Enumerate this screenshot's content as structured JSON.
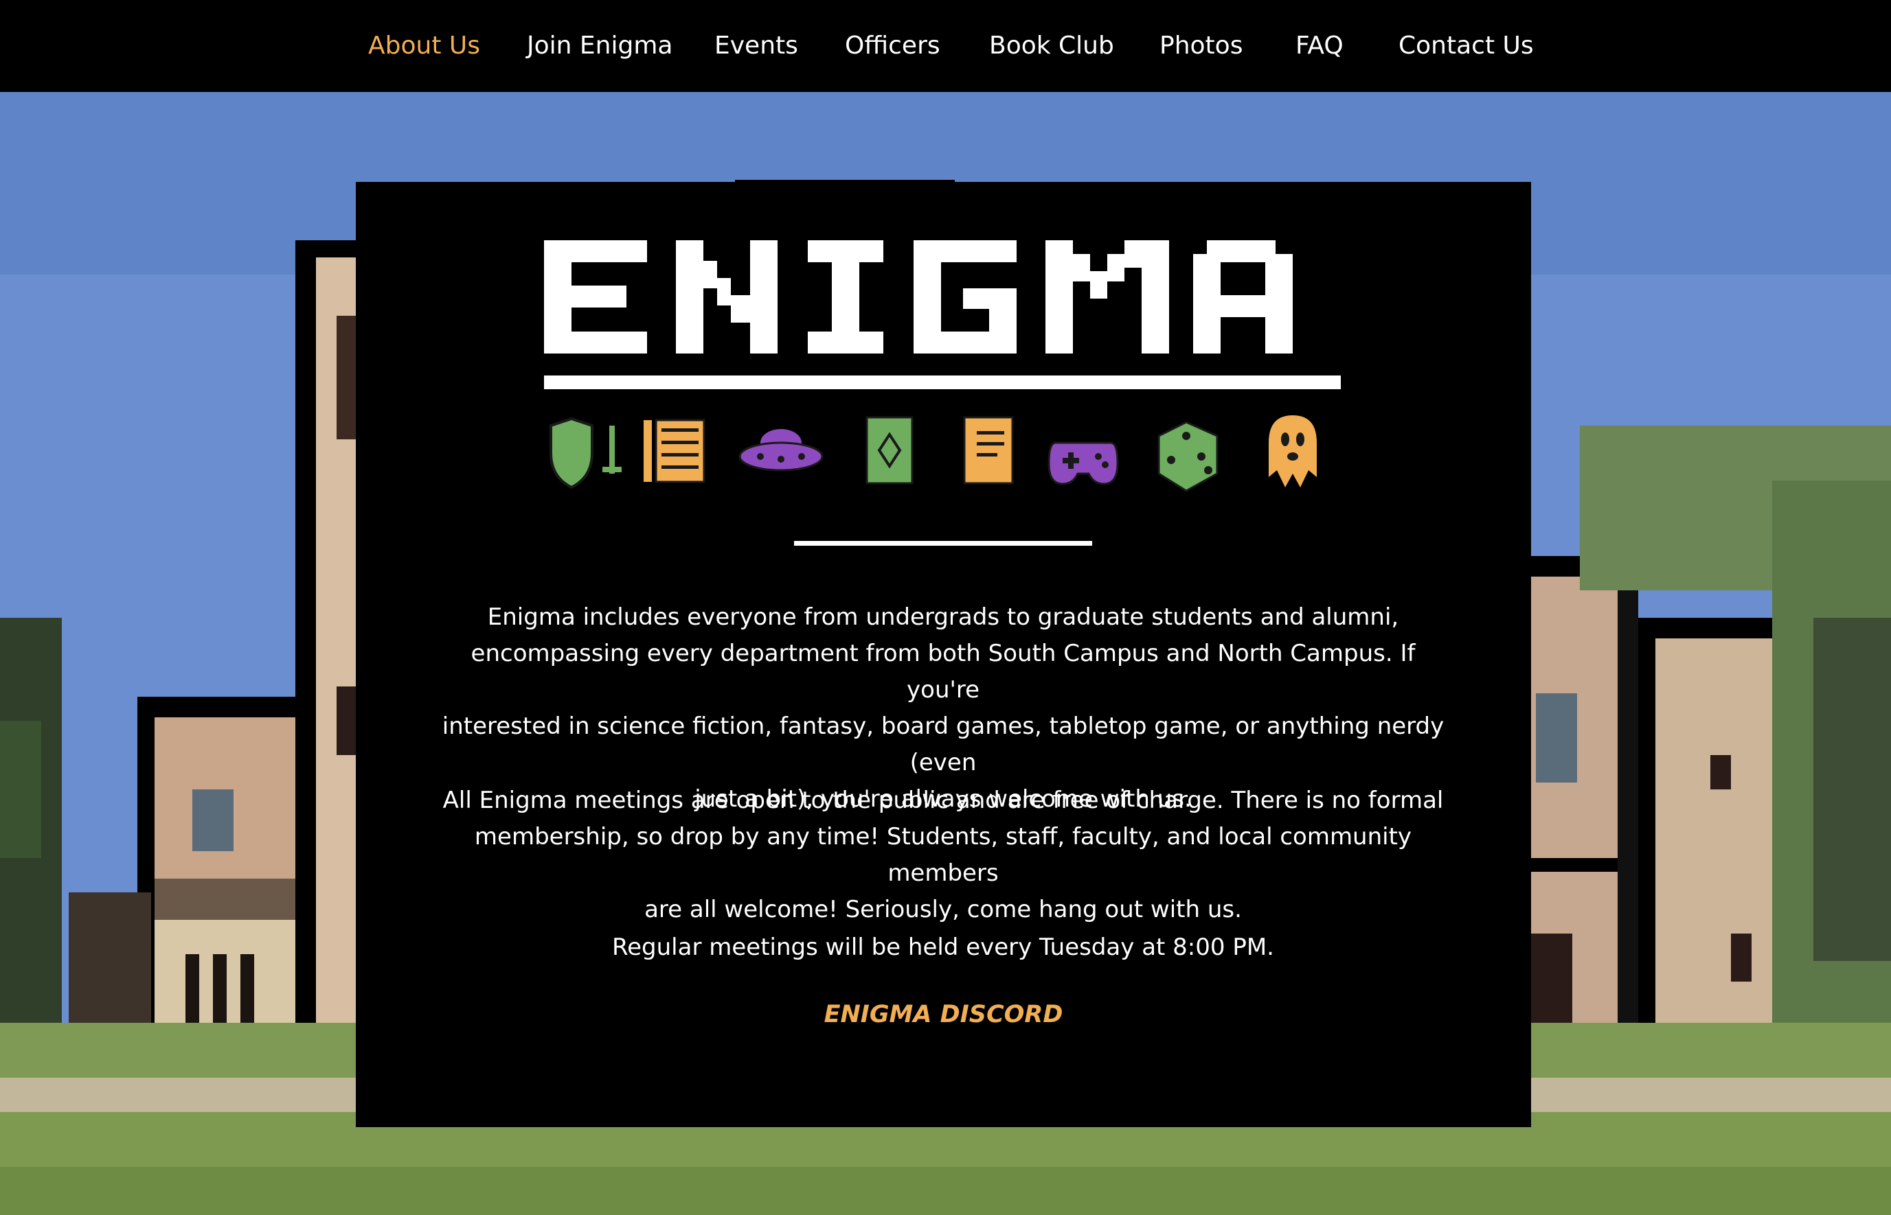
{
  "nav": {
    "items": [
      {
        "label": "About Us",
        "active": true
      },
      {
        "label": "Join Enigma",
        "active": false
      },
      {
        "label": "Events",
        "active": false
      },
      {
        "label": "Officers",
        "active": false
      },
      {
        "label": "Book Club",
        "active": false
      },
      {
        "label": "Photos",
        "active": false
      },
      {
        "label": "FAQ",
        "active": false
      },
      {
        "label": "Contact Us",
        "active": false
      }
    ]
  },
  "logo": {
    "wordmark": "ENIGMA",
    "icons": [
      "shield-sword-icon",
      "notebook-icon",
      "ufo-icon",
      "playing-card-icon",
      "book-icon",
      "gamepad-icon",
      "dice-icon",
      "ghost-icon"
    ]
  },
  "content": {
    "paragraph_1_lines": [
      "Enigma includes everyone from undergrads to graduate students and alumni,",
      "encompassing every department from both South Campus and North Campus. If you're",
      "interested in science fiction, fantasy, board games, tabletop game, or anything nerdy (even",
      "just a bit), you're always welcome with us."
    ],
    "paragraph_2_lines": [
      "All Enigma meetings are open to the public and are free of charge. There is no formal",
      "membership, so drop by any time! Students, staff, faculty, and local community members",
      "are all welcome! Seriously, come hang out with us."
    ],
    "paragraph_3": "Regular meetings will be held every Tuesday at 8:00 PM.",
    "discord_link": "ENIGMA DISCORD"
  },
  "colors": {
    "accent": "#f2ae52",
    "nav_bg": "#000000",
    "panel_bg": "#000000",
    "text": "#ffffff",
    "icon_green": "#6fae5e",
    "icon_orange": "#f2ae52",
    "icon_purple": "#8e4bbf"
  }
}
